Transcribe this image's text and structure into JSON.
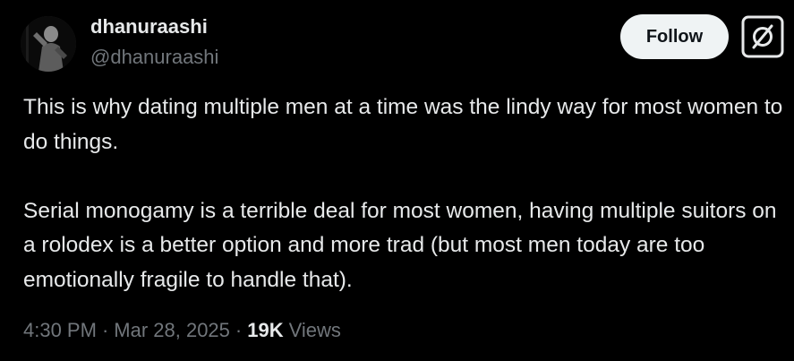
{
  "tweet": {
    "author": {
      "display_name": "dhanuraashi",
      "handle": "@dhanuraashi",
      "avatar_icon": "profile-photo"
    },
    "follow_label": "Follow",
    "grok_icon": "grok-icon",
    "paragraphs": [
      "This is why dating multiple men at a time was the lindy way for most women to do things.",
      "Serial monogamy is a terrible deal for most women, having multiple suitors on a rolodex is a better option and more trad (but most men today are too emotionally fragile to handle that)."
    ],
    "time": "4:30 PM",
    "separator": "·",
    "date": "Mar 28, 2025",
    "views_count": "19K",
    "views_label": "Views"
  },
  "colors": {
    "background": "#000000",
    "primary_text": "#e7e9ea",
    "secondary_text": "#71767b",
    "follow_button_bg": "#eff3f4",
    "follow_button_text": "#0f1419"
  }
}
